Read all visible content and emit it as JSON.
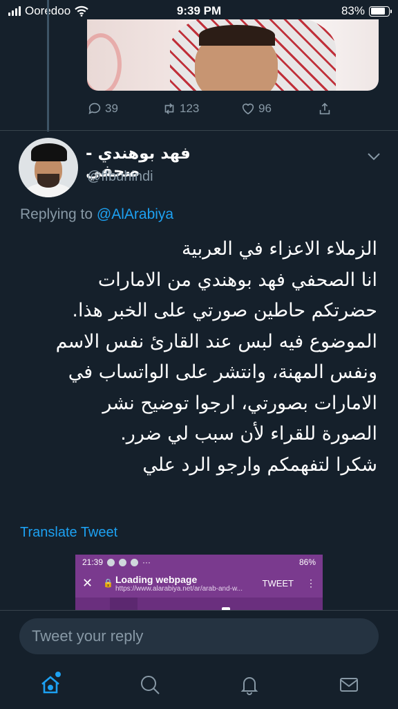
{
  "status_bar": {
    "carrier": "Ooredoo",
    "time": "9:39 PM",
    "battery": "83%",
    "battery_level": 0.83
  },
  "previous_tweet": {
    "actions": {
      "replies": "39",
      "retweets": "123",
      "likes": "96"
    }
  },
  "tweet": {
    "display_name": "فهد بوهندي - صحفي",
    "handle": "@ffbuhindi",
    "replying_prefix": "Replying to",
    "replying_to": "@AlArabiya",
    "body_lines": [
      "الزملاء الاعزاء في العربية",
      "انا الصحفي فهد بوهندي من الامارات",
      "حضرتكم حاطين صورتي على الخبر هذا.",
      "الموضوع فيه لبس عند القارئ نفس الاسم",
      "ونفس المهنة، وانتشر على الواتساب في",
      "الامارات بصورتي، ارجوا توضيح نشر",
      "الصورة للقراء لأن سبب لي ضرر.",
      "شكرا لتفهمكم وارجو الرد علي"
    ],
    "translate_label": "Translate Tweet"
  },
  "embedded_image": {
    "time": "21:39",
    "battery": "86%",
    "title": "Loading webpage",
    "url": "https://www.alarabiya.net/ar/arab-and-w...",
    "action": "TWEET"
  },
  "reply": {
    "placeholder": "Tweet your reply"
  },
  "tab_bar": {
    "active": "home",
    "icons": [
      "home-icon",
      "search-icon",
      "notifications-icon",
      "messages-icon"
    ]
  },
  "colors": {
    "background": "#15202b",
    "accent": "#1da1f2",
    "secondary_text": "#8899a6",
    "divider": "#38444d"
  }
}
